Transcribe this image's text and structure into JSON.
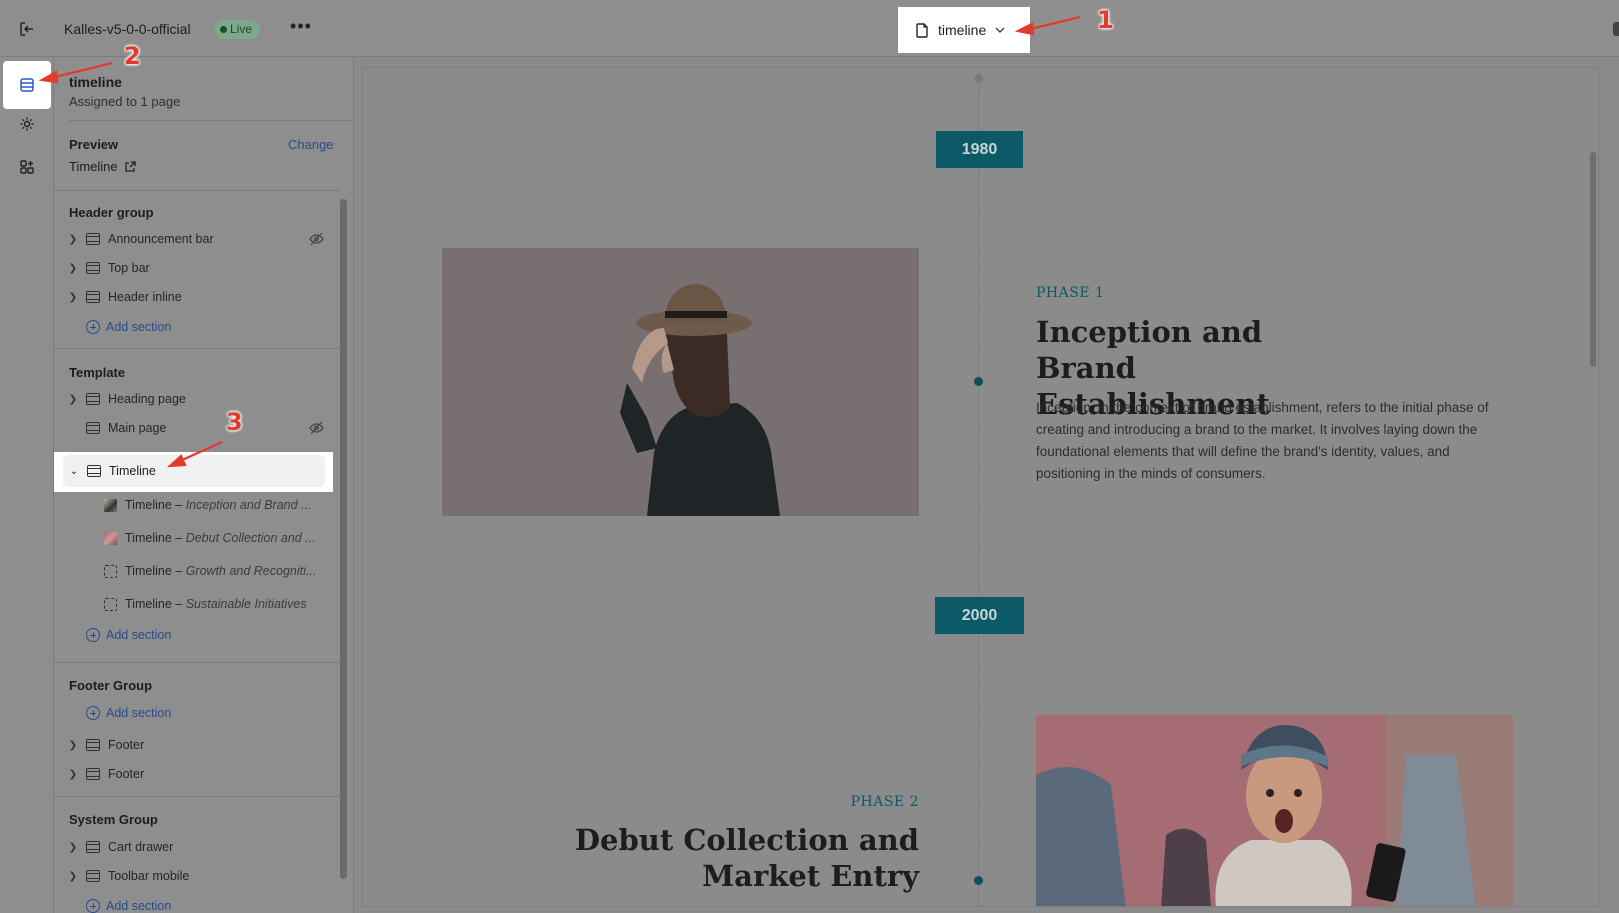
{
  "topbar": {
    "store_name": "Kalles-v5-0-0-official",
    "live_label": "Live",
    "more_label": "•••",
    "template_name": "timeline"
  },
  "sidebar": {
    "title": "timeline",
    "subtitle": "Assigned to 1 page",
    "preview_label": "Preview",
    "change_label": "Change",
    "preview_value": "Timeline",
    "groups": {
      "header": {
        "title": "Header group",
        "items": [
          "Announcement bar",
          "Top bar",
          "Header inline"
        ],
        "add_label": "Add section"
      },
      "template": {
        "title": "Template",
        "items": [
          "Heading page",
          "Main page"
        ],
        "selected": "Timeline",
        "blocks": [
          {
            "name": "Timeline",
            "sep": " – ",
            "title": "Inception and Brand ..."
          },
          {
            "name": "Timeline",
            "sep": " – ",
            "title": "Debut Collection and ..."
          },
          {
            "name": "Timeline",
            "sep": " – ",
            "title": "Growth and Recogniti..."
          },
          {
            "name": "Timeline",
            "sep": " – ",
            "title": "Sustainable Initiatives"
          }
        ],
        "add_label": "Add section"
      },
      "footer": {
        "title": "Footer Group",
        "add_label": "Add section",
        "items": [
          "Footer",
          "Footer"
        ]
      },
      "system": {
        "title": "System Group",
        "items": [
          "Cart drawer",
          "Toolbar mobile"
        ],
        "add_label": "Add section"
      }
    }
  },
  "preview": {
    "year1": "1980",
    "phase1_label": "PHASE 1",
    "phase1_title": "Inception and Brand Establishment",
    "phase1_desc": "Inception, in the context of brand establishment, refers to the initial phase of creating and introducing a brand to the market. It involves laying down the foundational elements that will define the brand's identity, values, and positioning in the minds of consumers.",
    "year2": "2000",
    "phase2_label": "PHASE 2",
    "phase2_title": "Debut Collection and Market Entry"
  },
  "annotations": [
    "1",
    "2",
    "3"
  ],
  "colors": {
    "accent_teal": "#0c5a67",
    "link_blue": "#2c4a8a",
    "annotation_red": "#e23b2e"
  }
}
